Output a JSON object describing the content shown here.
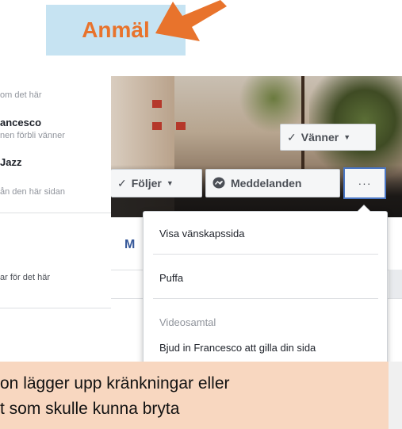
{
  "callout": {
    "label": "Anmäl"
  },
  "left_panel": {
    "line1": "om det här",
    "name": "ancesco",
    "line2": "nen förbli vänner",
    "jazz": "Jazz",
    "line3": "ån den här sidan",
    "line4": "ar för det här"
  },
  "profile_buttons": {
    "friends": "Vänner",
    "follows": "Följer",
    "messages": "Meddelanden",
    "more": "···"
  },
  "tab_partial": "M",
  "dropdown_menu": {
    "items": [
      {
        "label": "Visa vänskapssida",
        "enabled": true
      },
      {
        "label": "Puffa",
        "enabled": true
      },
      {
        "label": "Videosamtal",
        "enabled": false
      },
      {
        "label": "Bjud in Francesco att gilla din sida",
        "enabled": true
      }
    ]
  },
  "bottom_note": {
    "line1": "on lägger upp kränkningar eller",
    "line2": "t som skulle kunna bryta"
  },
  "colors": {
    "callout_bg": "#c6e3f2",
    "callout_text": "#e8732c",
    "note_bg": "#f8d7c0",
    "focus_border": "#4a76c4"
  },
  "icons": [
    "check-icon",
    "caret-down-icon",
    "messenger-icon",
    "more-icon",
    "arrow-pointer"
  ]
}
